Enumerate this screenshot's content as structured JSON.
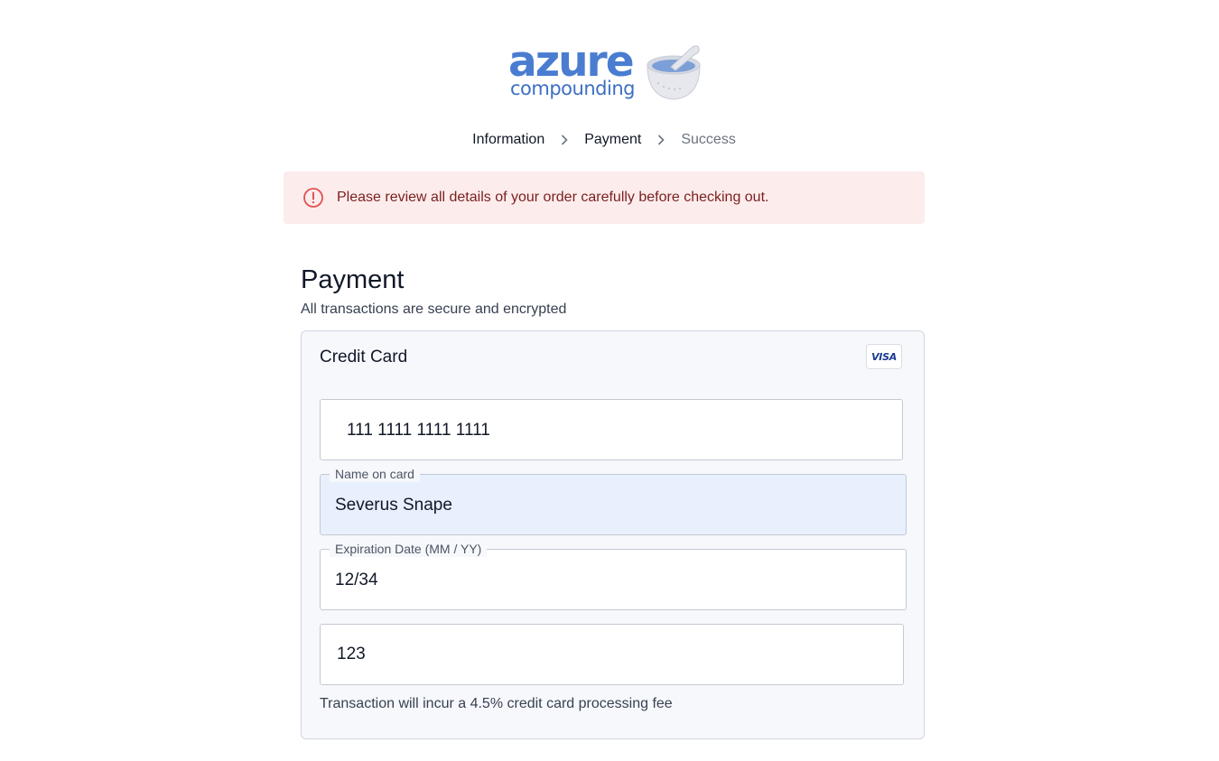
{
  "brand": {
    "name": "azure",
    "subtitle": "compounding",
    "color": "#4a7dd0"
  },
  "breadcrumb": {
    "steps": [
      {
        "label": "Information",
        "state": "completed"
      },
      {
        "label": "Payment",
        "state": "current"
      },
      {
        "label": "Success",
        "state": "upcoming"
      }
    ],
    "separator_icon": "chevron-right-icon"
  },
  "alert": {
    "icon": "exclamation-circle-icon",
    "text": "Please review all details of your order carefully before checking out.",
    "background": "#fdecec",
    "text_color": "#7a1f1f"
  },
  "payment": {
    "title": "Payment",
    "subtitle": "All transactions are secure and encrypted"
  },
  "card": {
    "title": "Credit Card",
    "brand_badge": "VISA",
    "fields": {
      "card_number": {
        "value": "111 1111 1111 1111"
      },
      "name_on_card": {
        "label": "Name on card",
        "value": "Severus Snape"
      },
      "expiration": {
        "label": "Expiration Date (MM / YY)",
        "value": "12/34"
      },
      "cvv": {
        "value": "123"
      }
    },
    "fee_note": "Transaction will incur a 4.5% credit card processing fee"
  }
}
